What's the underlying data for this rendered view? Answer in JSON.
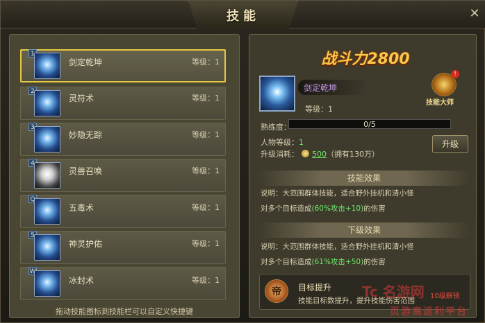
{
  "window": {
    "title": "技能",
    "close_label": "✕"
  },
  "skills": [
    {
      "key": "1",
      "name": "剑定乾坤",
      "level": "等级：1",
      "selected": true
    },
    {
      "key": "2",
      "name": "灵符术",
      "level": "等级：1"
    },
    {
      "key": "3",
      "name": "妙隐无踪",
      "level": "等级：1"
    },
    {
      "key": "4",
      "name": "灵兽召唤",
      "level": "等级：1"
    },
    {
      "key": "Q",
      "name": "五毒术",
      "level": "等级：1"
    },
    {
      "key": "5",
      "name": "神灵护佑",
      "level": "等级：1"
    },
    {
      "key": "W",
      "name": "冰封术",
      "level": "等级：1"
    }
  ],
  "footer_note": "拖动技能图标到技能栏可以自定义快捷键",
  "detail": {
    "power": "战斗力2800",
    "skill_name": "剑定乾坤",
    "skill_level": "等级：1",
    "master_label": "技能大师",
    "master_badge": "!",
    "proficiency_label": "熟练度：",
    "proficiency_text": "0/5",
    "proficiency_fraction": 0,
    "char_level_label": "人物等级：",
    "char_level_value": "1",
    "upgrade_cost_label": "升级消耗：",
    "upgrade_cost_value": "500",
    "owned_text": "（拥有130万）",
    "upgrade_button": "升级",
    "effect_header": "技能效果",
    "effect_desc": "说明：大范围群体技能，适合野外挂机和清小怪",
    "effect_damage_pre": "对多个目标造成",
    "effect_damage_hl": "(60%攻击+10)",
    "effect_damage_post": "的伤害",
    "next_header": "下级效果",
    "next_desc": "说明：大范围群体技能，适合野外挂机和清小怪",
    "next_damage_pre": "对多个目标造成",
    "next_damage_hl": "(61%攻击+50)",
    "next_damage_post": "的伤害",
    "target_icon": "帝",
    "target_title": "目标提升",
    "target_desc": "技能目标数提升，提升技能伤害范围",
    "target_level": "10级解锁"
  },
  "watermark": {
    "main": "Tc 名游网",
    "sub": "页游高返利平台"
  },
  "colors": {
    "accent": "#f6c94a",
    "highlight": "#6fe86a",
    "selected_border": "#e6c840",
    "purple_name": "#c79af0"
  }
}
